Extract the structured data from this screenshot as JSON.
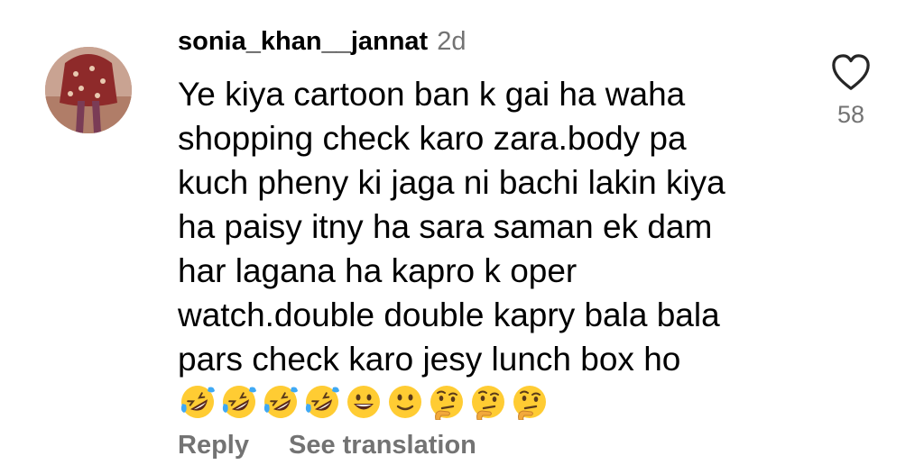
{
  "comment": {
    "username": "sonia_khan__jannat",
    "timestamp": "2d",
    "text": "Ye kiya cartoon ban k gai ha waha shopping check karo zara.body pa kuch pheny ki jaga ni bachi lakin kiya ha paisy itny ha sara saman ek dam har lagana ha kapro k oper watch.double double kapry bala bala pars check karo jesy lunch box ho",
    "emojis": [
      "rolling-on-floor-laughing",
      "rolling-on-floor-laughing",
      "rolling-on-floor-laughing",
      "rolling-on-floor-laughing",
      "grinning-face",
      "slightly-smiling-face",
      "thinking-face",
      "thinking-face",
      "thinking-face"
    ],
    "like_icon": "heart-outline-icon",
    "like_count": "58",
    "actions": {
      "reply_label": "Reply",
      "translate_label": "See translation"
    }
  },
  "colors": {
    "text_primary": "#000000",
    "text_secondary": "#737373",
    "emoji_yellow": "#FFCC33",
    "emoji_tear": "#3FA9F5"
  }
}
